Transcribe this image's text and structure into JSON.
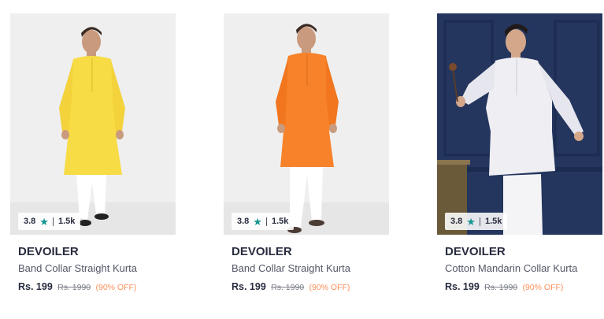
{
  "products": [
    {
      "brand": "DEVOILER",
      "name": "Band Collar Straight Kurta",
      "price": "Rs. 199",
      "mrp": "Rs. 1990",
      "discount": "(90% OFF)",
      "rating": "3.8",
      "rating_count": "1.5k",
      "kurta_color": "#f7dc45",
      "background_color": "#efefef"
    },
    {
      "brand": "DEVOILER",
      "name": "Band Collar Straight Kurta",
      "price": "Rs. 199",
      "mrp": "Rs. 1990",
      "discount": "(90% OFF)",
      "rating": "3.8",
      "rating_count": "1.5k",
      "kurta_color": "#f7822a",
      "background_color": "#efefef"
    },
    {
      "brand": "DEVOILER",
      "name": "Cotton Mandarin Collar Kurta",
      "price": "Rs. 199",
      "mrp": "Rs. 1990",
      "discount": "(90% OFF)",
      "rating": "3.8",
      "rating_count": "1.5k",
      "kurta_color": "#eeeef3",
      "background_color": "#24365e"
    }
  ],
  "icons": {
    "rating_star": "star-icon"
  },
  "colors": {
    "rating_star": "#14958f",
    "discount": "#ff905a",
    "brand_text": "#282c3f"
  }
}
